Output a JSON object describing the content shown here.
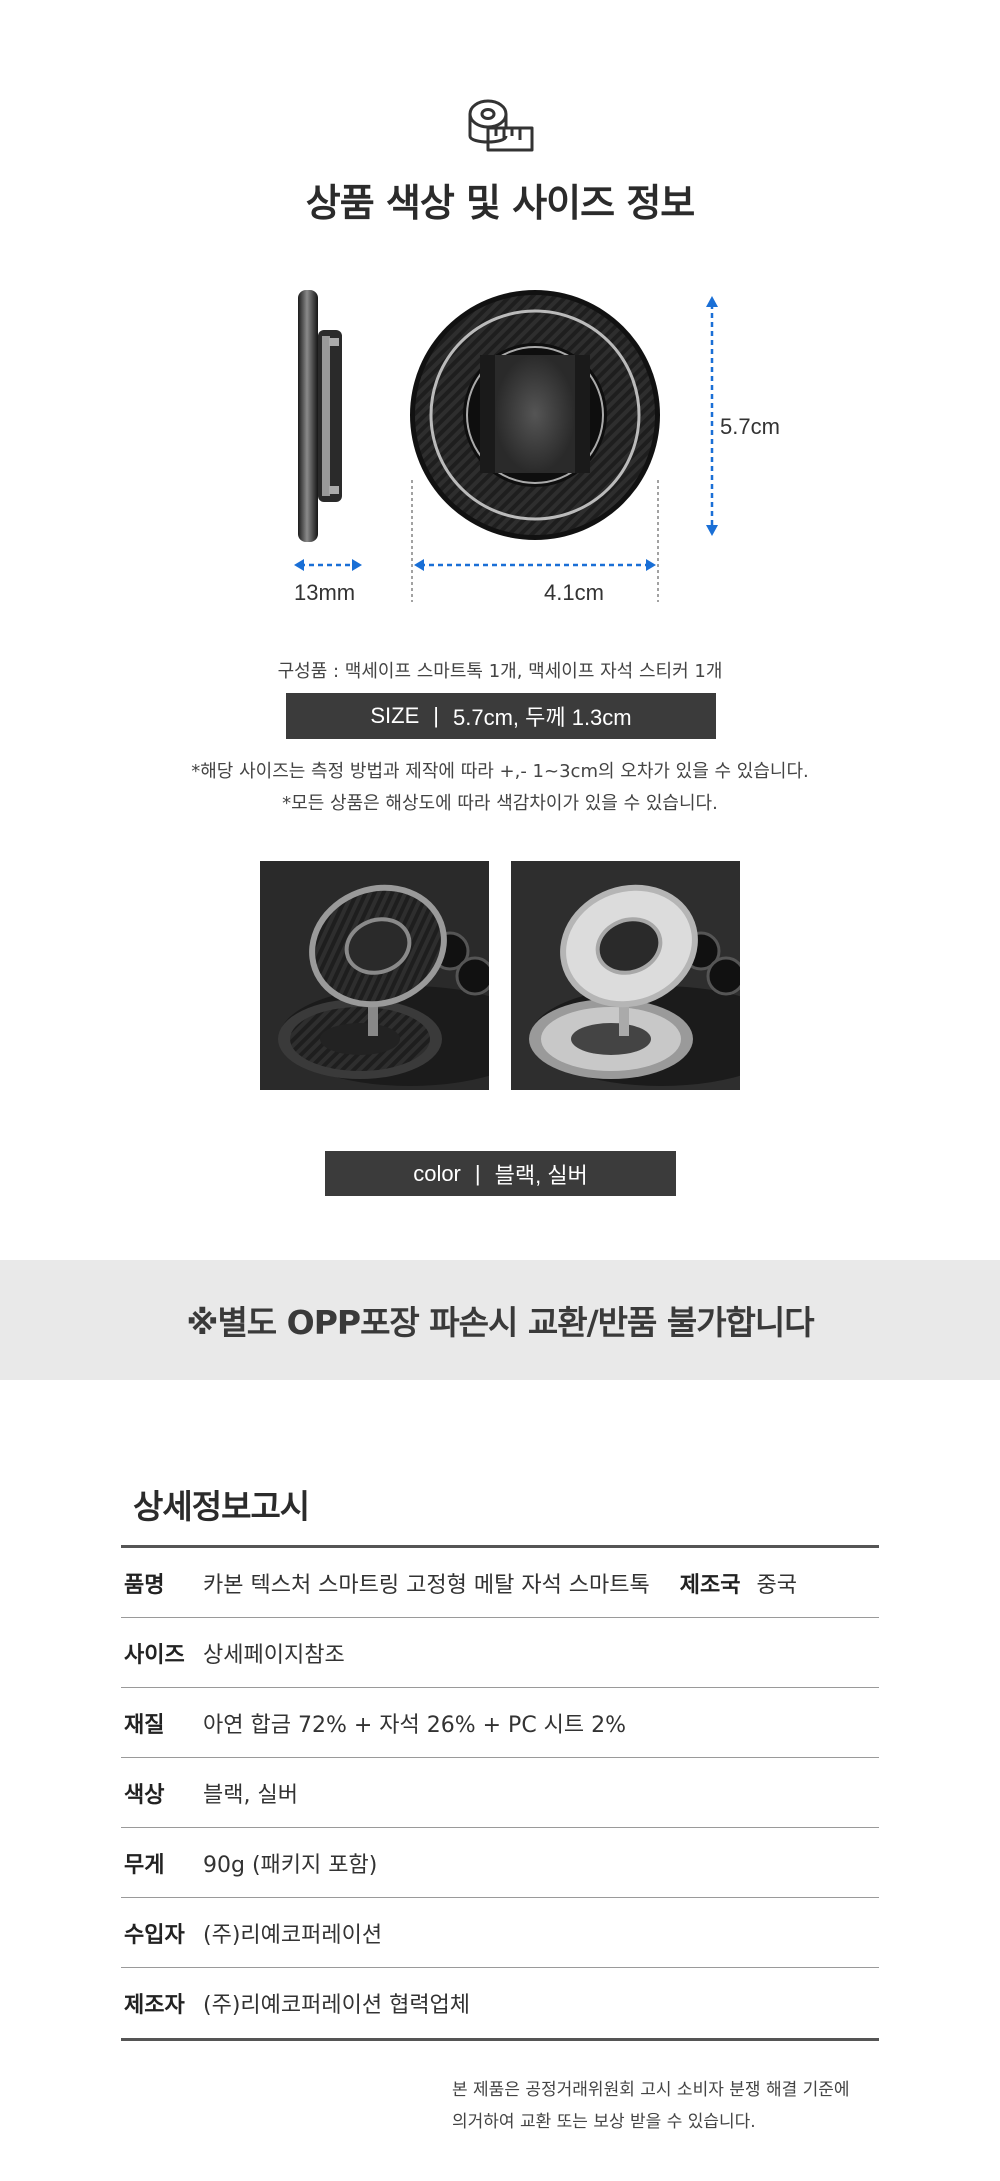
{
  "header": {
    "title": "상품 색상 및 사이즈 정보",
    "icon": "tape-measure-icon"
  },
  "dimensions": {
    "thickness": "13mm",
    "inner_width": "4.1cm",
    "height": "5.7cm"
  },
  "components": "구성품 : 맥세이프 스마트톡 1개, 맥세이프 자석 스티커 1개",
  "size_bar": {
    "label": "SIZE",
    "separator": "|",
    "value": "5.7cm, 두께 1.3cm"
  },
  "notes": [
    "*해당 사이즈는 측정 방법과 제작에 따라 +,- 1~3cm의 오차가 있을 수 있습니다.",
    "*모든 상품은 해상도에 따라 색감차이가 있을 수 있습니다."
  ],
  "color_bar": {
    "label": "color",
    "separator": "|",
    "value": "블랙, 실버"
  },
  "notice": "※별도 OPP포장 파손시 교환/반품 불가합니다",
  "info": {
    "title": "상세정보고시",
    "rows": [
      {
        "label": "품명",
        "value": "카본 텍스처 스마트링 고정형 메탈 자석 스마트톡",
        "label2": "제조국",
        "value2": "중국"
      },
      {
        "label": "사이즈",
        "value": "상세페이지참조"
      },
      {
        "label": "재질",
        "value": "아연 합금 72% + 자석 26% + PC 시트 2%"
      },
      {
        "label": "색상",
        "value": "블랙, 실버"
      },
      {
        "label": "무게",
        "value": "90g (패키지 포함)"
      },
      {
        "label": "수입자",
        "value": "(주)리예코퍼레이션"
      },
      {
        "label": "제조자",
        "value": "(주)리예코퍼레이션 협력업체"
      }
    ]
  },
  "disclaimer": [
    "본 제품은 공정거래위원회 고시 소비자 분쟁 해결 기준에",
    "의거하여 교환 또는 보상 받을 수 있습니다."
  ],
  "colors": {
    "dimension_arrow": "#1a6fd6",
    "dark_bar": "#3b3b3b",
    "notice_band": "#e9e9e9"
  }
}
